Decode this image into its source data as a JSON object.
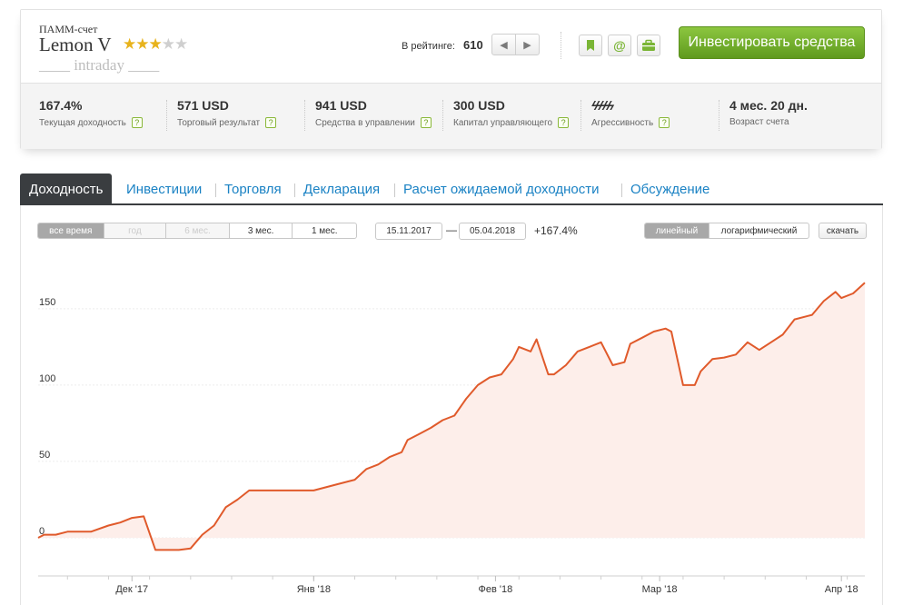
{
  "account": {
    "type": "ПАММ-счет",
    "name": "Lemon V",
    "stars_filled": 3,
    "stars_total": 5,
    "tag": "____ intraday ____"
  },
  "rating": {
    "label": "В рейтинге:",
    "value": "610"
  },
  "invest_button": "Инвестировать средства",
  "stats": [
    {
      "value": "167.4%",
      "label": "Текущая доходность",
      "help": "?"
    },
    {
      "value": "571 USD",
      "label": "Торговый результат",
      "help": "?"
    },
    {
      "value": "941 USD",
      "label": "Средства в управлении",
      "help": "?"
    },
    {
      "value": "300 USD",
      "label": "Капитал управляющего",
      "help": "?"
    },
    {
      "value": "ϟϟϟϟϟ",
      "label": "Агрессивность",
      "help": "?"
    },
    {
      "value": "4 мес. 20 дн.",
      "label": "Возраст счета",
      "help": ""
    }
  ],
  "tabs": [
    {
      "label": "Доходность",
      "active": true
    },
    {
      "label": "Инвестиции",
      "active": false
    },
    {
      "label": "Торговля",
      "active": false
    },
    {
      "label": "Декларация",
      "active": false
    },
    {
      "label": "Расчет ожидаемой доходности",
      "active": false
    },
    {
      "label": "Обсуждение",
      "active": false
    }
  ],
  "period_buttons": [
    {
      "label": "все время",
      "state": "selected"
    },
    {
      "label": "год",
      "state": "disabled"
    },
    {
      "label": "6 мес.",
      "state": "disabled"
    },
    {
      "label": "3 мес.",
      "state": "normal"
    },
    {
      "label": "1 мес.",
      "state": "normal"
    }
  ],
  "date_range": {
    "from": "15.11.2017",
    "separator": "—",
    "to": "05.04.2018",
    "change": "+167.4%"
  },
  "scale_buttons": [
    {
      "label": "линейный",
      "state": "selected"
    },
    {
      "label": "логарифмический",
      "state": "normal"
    }
  ],
  "download_button": "скачать",
  "colors": {
    "line": "#e05a2b",
    "area": "#fdeeea",
    "accent_green": "#7ab535",
    "tab_dark": "#3a3d40",
    "link_blue": "#1a82c4",
    "star": "#e8b31c"
  },
  "chart_data": {
    "type": "area",
    "title": "",
    "xlabel": "",
    "ylabel": "",
    "y_ticks": [
      0,
      50,
      100,
      150
    ],
    "ylim": [
      -25,
      185
    ],
    "x_tick_labels": [
      "Дек '17",
      "Янв '18",
      "Фев '18",
      "Мар '18",
      "Апр '18"
    ],
    "x_tick_dates": [
      "2017-12-01",
      "2018-01-01",
      "2018-02-01",
      "2018-03-01",
      "2018-04-01"
    ],
    "grid": true,
    "legend": "none",
    "series": [
      {
        "x": [
          "2017-11-15",
          "2017-11-16",
          "2017-11-18",
          "2017-11-20",
          "2017-11-22",
          "2017-11-24",
          "2017-11-27",
          "2017-11-29",
          "2017-12-01",
          "2017-12-03",
          "2017-12-05",
          "2017-12-07",
          "2017-12-09",
          "2017-12-11",
          "2017-12-13",
          "2017-12-15",
          "2017-12-17",
          "2017-12-19",
          "2017-12-21",
          "2017-12-23",
          "2017-12-26",
          "2017-12-28",
          "2018-01-01",
          "2018-01-05",
          "2018-01-08",
          "2018-01-10",
          "2018-01-12",
          "2018-01-14",
          "2018-01-16",
          "2018-01-17",
          "2018-01-19",
          "2018-01-21",
          "2018-01-23",
          "2018-01-25",
          "2018-01-27",
          "2018-01-29",
          "2018-01-31",
          "2018-02-02",
          "2018-02-04",
          "2018-02-05",
          "2018-02-07",
          "2018-02-08",
          "2018-02-10",
          "2018-02-11",
          "2018-02-13",
          "2018-02-15",
          "2018-02-17",
          "2018-02-19",
          "2018-02-21",
          "2018-02-23",
          "2018-02-24",
          "2018-02-26",
          "2018-02-28",
          "2018-03-02",
          "2018-03-03",
          "2018-03-05",
          "2018-03-07",
          "2018-03-08",
          "2018-03-10",
          "2018-03-12",
          "2018-03-14",
          "2018-03-16",
          "2018-03-18",
          "2018-03-20",
          "2018-03-22",
          "2018-03-24",
          "2018-03-27",
          "2018-03-29",
          "2018-03-31",
          "2018-04-01",
          "2018-04-03",
          "2018-04-05"
        ],
        "values": [
          0,
          2,
          2,
          4,
          4,
          4,
          8,
          10,
          13,
          14,
          -8,
          -8,
          -8,
          -7,
          2,
          8,
          20,
          25,
          31,
          31,
          31,
          31,
          31,
          35,
          38,
          45,
          48,
          53,
          56,
          64,
          68,
          72,
          77,
          80,
          91,
          100,
          105,
          107,
          117,
          125,
          122,
          130,
          107,
          107,
          113,
          122,
          125,
          128,
          113,
          115,
          127,
          131,
          135,
          137,
          135,
          100,
          100,
          109,
          117,
          118,
          120,
          128,
          123,
          128,
          133,
          143,
          146,
          155,
          161,
          157,
          160,
          167
        ]
      }
    ]
  }
}
